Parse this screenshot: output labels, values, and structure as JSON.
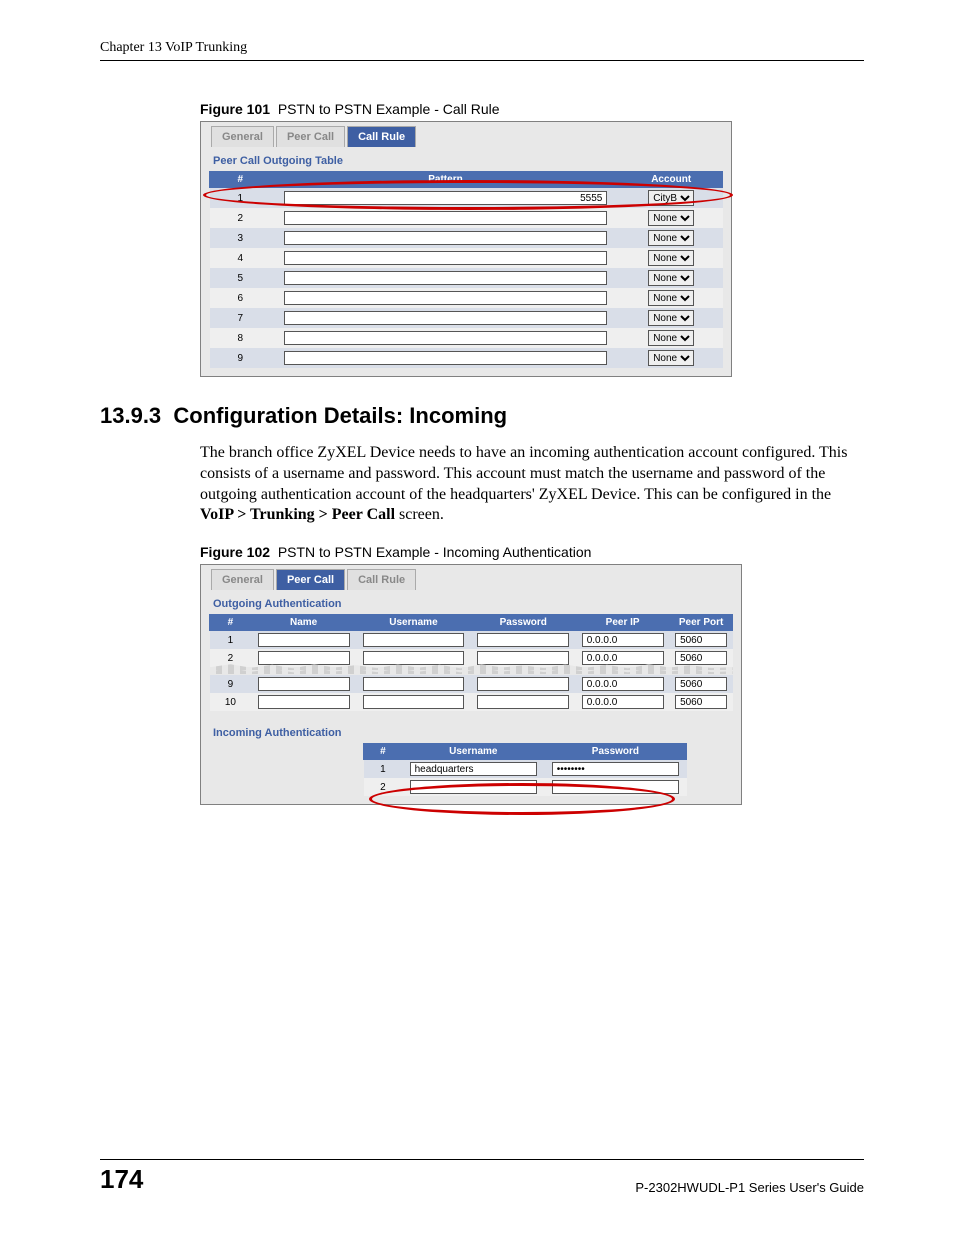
{
  "header": {
    "chapter": "Chapter 13 VoIP Trunking"
  },
  "figure101": {
    "label": "Figure 101",
    "title": "PSTN to PSTN Example - Call Rule",
    "tabs": {
      "general": "General",
      "peercall": "Peer Call",
      "callrule": "Call Rule"
    },
    "table_title": "Peer Call Outgoing Table",
    "columns": {
      "num": "#",
      "pattern": "Pattern",
      "account": "Account"
    },
    "rows": [
      {
        "n": "1",
        "pattern": "5555",
        "account": "CityB"
      },
      {
        "n": "2",
        "pattern": "",
        "account": "None"
      },
      {
        "n": "3",
        "pattern": "",
        "account": "None"
      },
      {
        "n": "4",
        "pattern": "",
        "account": "None"
      },
      {
        "n": "5",
        "pattern": "",
        "account": "None"
      },
      {
        "n": "6",
        "pattern": "",
        "account": "None"
      },
      {
        "n": "7",
        "pattern": "",
        "account": "None"
      },
      {
        "n": "8",
        "pattern": "",
        "account": "None"
      },
      {
        "n": "9",
        "pattern": "",
        "account": "None"
      }
    ]
  },
  "section": {
    "number": "13.9.3",
    "title": "Configuration Details: Incoming",
    "para1a": "The branch office ZyXEL Device needs to have an incoming authentication account configured. This consists of a username and password. This account must match the username and password of the outgoing authentication account of the headquarters' ZyXEL Device. This can be configured in the ",
    "para1b": "VoIP > Trunking > Peer Call",
    "para1c": " screen."
  },
  "figure102": {
    "label": "Figure 102",
    "title": "PSTN to PSTN Example - Incoming Authentication",
    "tabs": {
      "general": "General",
      "peercall": "Peer Call",
      "callrule": "Call Rule"
    },
    "out_title": "Outgoing Authentication",
    "out_cols": {
      "num": "#",
      "name": "Name",
      "user": "Username",
      "pass": "Password",
      "ip": "Peer IP",
      "port": "Peer Port"
    },
    "out_rows": [
      {
        "n": "1",
        "name": "",
        "user": "",
        "pass": "",
        "ip": "0.0.0.0",
        "port": "5060"
      },
      {
        "n": "2",
        "name": "",
        "user": "",
        "pass": "",
        "ip": "0.0.0.0",
        "port": "5060"
      },
      {
        "n": "",
        "name": "",
        "user": "",
        "pass": "",
        "ip": "0.0.0.0",
        "port": "5060"
      },
      {
        "n": "9",
        "name": "",
        "user": "",
        "pass": "",
        "ip": "0.0.0.0",
        "port": "5060"
      },
      {
        "n": "10",
        "name": "",
        "user": "",
        "pass": "",
        "ip": "0.0.0.0",
        "port": "5060"
      }
    ],
    "in_title": "Incoming Authentication",
    "in_cols": {
      "num": "#",
      "user": "Username",
      "pass": "Password"
    },
    "in_rows": [
      {
        "n": "1",
        "user": "headquarters",
        "pass": "••••••••"
      },
      {
        "n": "2",
        "user": "",
        "pass": ""
      }
    ]
  },
  "footer": {
    "page": "174",
    "guide": "P-2302HWUDL-P1 Series User's Guide"
  }
}
